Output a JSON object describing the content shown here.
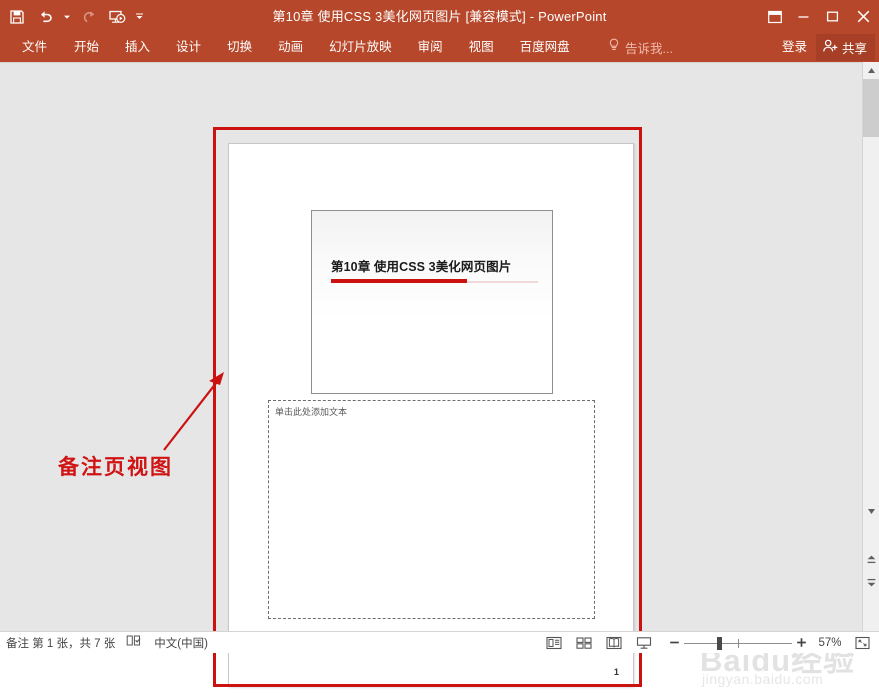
{
  "window": {
    "title": "第10章  使用CSS 3美化网页图片 [兼容模式] - PowerPoint",
    "quick_access": [
      {
        "name": "save",
        "label": "保存"
      },
      {
        "name": "undo",
        "label": "撤消"
      },
      {
        "name": "undo-dropdown",
        "label": "撤消下拉"
      },
      {
        "name": "redo",
        "label": "恢复"
      },
      {
        "name": "start-slideshow",
        "label": "从头开始"
      },
      {
        "name": "customize-qat",
        "label": "自定义快速访问工具栏"
      }
    ],
    "controls": [
      {
        "name": "ribbon-display-options",
        "label": "功能区显示选项"
      },
      {
        "name": "minimize",
        "label": "最小化"
      },
      {
        "name": "maximize",
        "label": "最大化"
      },
      {
        "name": "close",
        "label": "关闭"
      }
    ]
  },
  "ribbon": {
    "tabs": [
      {
        "id": "file",
        "label": "文件"
      },
      {
        "id": "home",
        "label": "开始"
      },
      {
        "id": "insert",
        "label": "插入"
      },
      {
        "id": "design",
        "label": "设计"
      },
      {
        "id": "transitions",
        "label": "切换"
      },
      {
        "id": "animations",
        "label": "动画"
      },
      {
        "id": "slideshow",
        "label": "幻灯片放映"
      },
      {
        "id": "review",
        "label": "审阅"
      },
      {
        "id": "view",
        "label": "视图"
      },
      {
        "id": "baidu-netdisk",
        "label": "百度网盘"
      }
    ],
    "tell_me": "告诉我...",
    "sign_in": "登录",
    "share": "共享"
  },
  "notes_page": {
    "slide": {
      "title": "第10章  使用CSS 3美化网页图片"
    },
    "notes_placeholder": "单击此处添加文本",
    "page_number": "1"
  },
  "annotation": {
    "label": "备注页视图",
    "color": "#d01414"
  },
  "watermark": {
    "main": "Baidu经验",
    "sub": "jingyan.baidu.com"
  },
  "status_bar": {
    "slide_info": "备注 第 1 张，共 7 张",
    "accessibility_label": "辅助功能检查器",
    "language": "中文(中国)",
    "views": [
      {
        "id": "normal",
        "label": "普通视图"
      },
      {
        "id": "slide-sorter",
        "label": "幻灯片浏览"
      },
      {
        "id": "reading-view",
        "label": "阅读视图"
      },
      {
        "id": "slide-show",
        "label": "幻灯片放映"
      }
    ],
    "zoom_out": "−",
    "zoom_in": "+",
    "zoom_level": "57%",
    "fit_to_window_label": "使幻灯片适应当前窗口"
  },
  "theme": {
    "accent": "#b7472a",
    "accent_dark": "#a63f25",
    "annotation_red": "#cc1111",
    "slide_rule": "#cc1111"
  }
}
